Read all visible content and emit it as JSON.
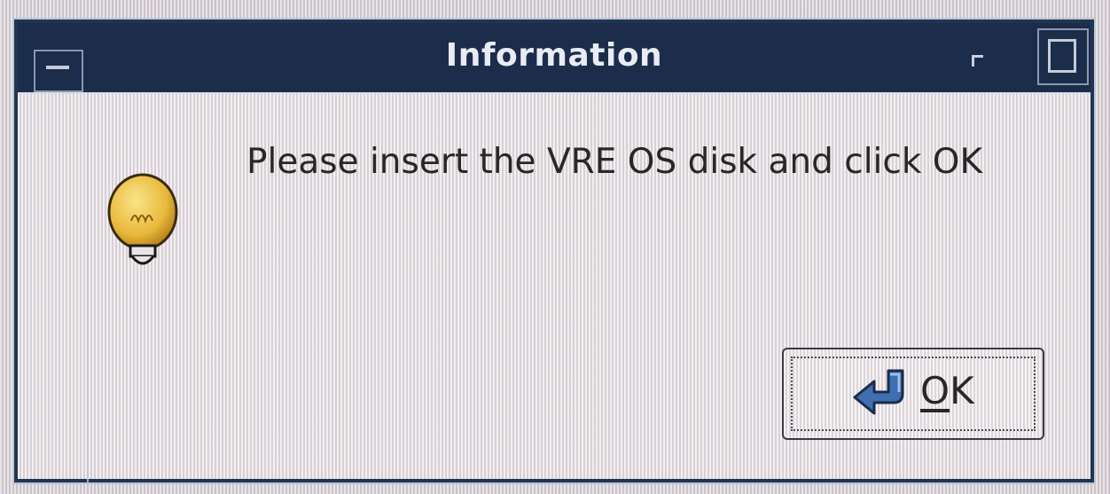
{
  "window": {
    "title": "Information"
  },
  "dialog": {
    "message": "Please insert the VRE OS disk and click OK",
    "icon": "lightbulb-icon"
  },
  "ok_button": {
    "mnemonic": "O",
    "rest": "K",
    "icon": "enter-arrow-icon"
  },
  "colors": {
    "titlebar": "#1b2d4a",
    "title_text": "#e9ecf4",
    "bulb": "#e8b93a",
    "arrow": "#3f6fb0"
  }
}
